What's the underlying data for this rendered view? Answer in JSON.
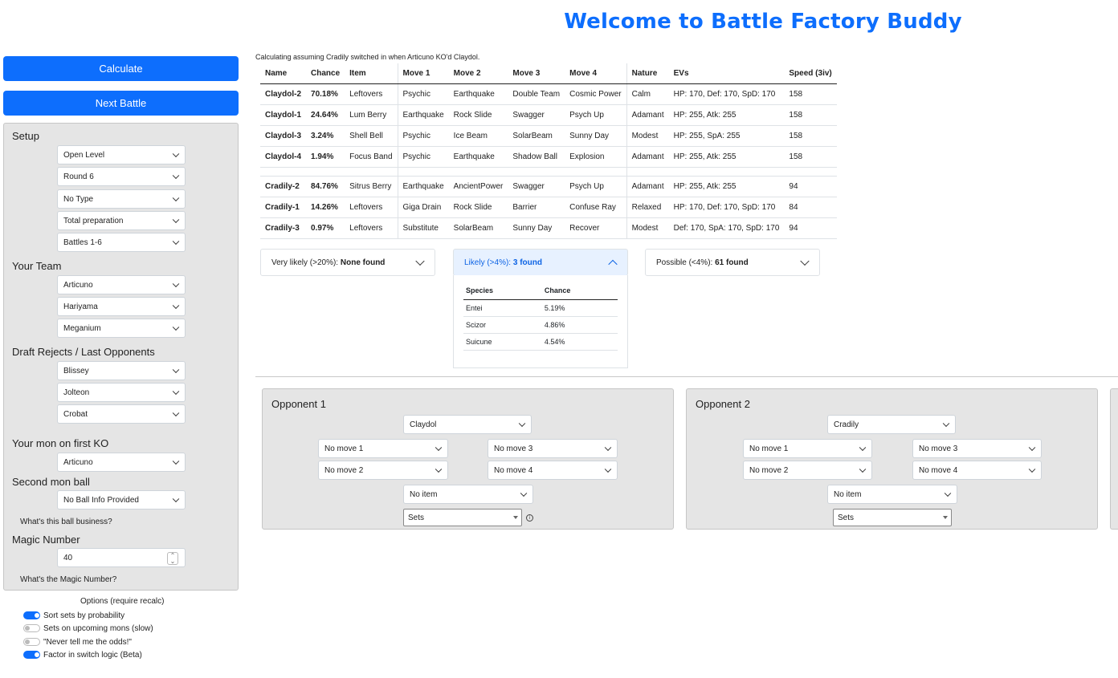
{
  "title": "Welcome to Battle Factory Buddy",
  "buttons": {
    "calculate": "Calculate",
    "next_battle": "Next Battle"
  },
  "setup": {
    "heading": "Setup",
    "level": "Open Level",
    "round": "Round 6",
    "type": "No Type",
    "preparation": "Total preparation",
    "battles": "Battles 1-6"
  },
  "team": {
    "heading": "Your Team",
    "members": [
      "Articuno",
      "Hariyama",
      "Meganium"
    ]
  },
  "rejects": {
    "heading": "Draft Rejects / Last Opponents",
    "members": [
      "Blissey",
      "Jolteon",
      "Crobat"
    ]
  },
  "first_ko": {
    "heading": "Your mon on first KO",
    "value": "Articuno"
  },
  "second_ball": {
    "heading": "Second mon ball",
    "value": "No Ball Info Provided",
    "help": "What's this ball business?"
  },
  "magic": {
    "heading": "Magic Number",
    "value": "40",
    "help": "What's the Magic Number?"
  },
  "options": {
    "heading": "Options (require recalc)",
    "items": [
      {
        "label": "Sort sets by probability",
        "on": true
      },
      {
        "label": "Sets on upcoming mons (slow)",
        "on": false
      },
      {
        "label": "\"Never tell me the odds!\"",
        "on": false
      },
      {
        "label": "Factor in switch logic (Beta)",
        "on": true
      }
    ]
  },
  "calc_note": "Calculating assuming Cradily switched in when Articuno KO'd Claydol.",
  "sets_table": {
    "headers": [
      "Name",
      "Chance",
      "Item",
      "Move 1",
      "Move 2",
      "Move 3",
      "Move 4",
      "Nature",
      "EVs",
      "Speed (3iv)"
    ],
    "group1": [
      [
        "Claydol-2",
        "70.18%",
        "Leftovers",
        "Psychic",
        "Earthquake",
        "Double Team",
        "Cosmic Power",
        "Calm",
        "HP: 170, Def: 170, SpD: 170",
        "158"
      ],
      [
        "Claydol-1",
        "24.64%",
        "Lum Berry",
        "Earthquake",
        "Rock Slide",
        "Swagger",
        "Psych Up",
        "Adamant",
        "HP: 255, Atk: 255",
        "158"
      ],
      [
        "Claydol-3",
        "3.24%",
        "Shell Bell",
        "Psychic",
        "Ice Beam",
        "SolarBeam",
        "Sunny Day",
        "Modest",
        "HP: 255, SpA: 255",
        "158"
      ],
      [
        "Claydol-4",
        "1.94%",
        "Focus Band",
        "Psychic",
        "Earthquake",
        "Shadow Ball",
        "Explosion",
        "Adamant",
        "HP: 255, Atk: 255",
        "158"
      ]
    ],
    "group2": [
      [
        "Cradily-2",
        "84.76%",
        "Sitrus Berry",
        "Earthquake",
        "AncientPower",
        "Swagger",
        "Psych Up",
        "Adamant",
        "HP: 255, Atk: 255",
        "94"
      ],
      [
        "Cradily-1",
        "14.26%",
        "Leftovers",
        "Giga Drain",
        "Rock Slide",
        "Barrier",
        "Confuse Ray",
        "Relaxed",
        "HP: 170, Def: 170, SpD: 170",
        "84"
      ],
      [
        "Cradily-3",
        "0.97%",
        "Leftovers",
        "Substitute",
        "SolarBeam",
        "Sunny Day",
        "Recover",
        "Modest",
        "Def: 170, SpA: 170, SpD: 170",
        "94"
      ]
    ]
  },
  "accordions": {
    "very_likely": {
      "label": "Very likely (>20%): ",
      "count": "None found"
    },
    "likely": {
      "label": "Likely (>4%): ",
      "count": "3 found"
    },
    "possible": {
      "label": "Possible (<4%): ",
      "count": "61 found"
    }
  },
  "likely_table": {
    "headers": [
      "Species",
      "Chance"
    ],
    "rows": [
      [
        "Entei",
        "5.19%"
      ],
      [
        "Scizor",
        "4.86%"
      ],
      [
        "Suicune",
        "4.54%"
      ]
    ]
  },
  "opponents": [
    {
      "title": "Opponent 1",
      "species": "Claydol",
      "move1": "No move 1",
      "move2": "No move 2",
      "move3": "No move 3",
      "move4": "No move 4",
      "item": "No item",
      "sets": "Sets"
    },
    {
      "title": "Opponent 2",
      "species": "Cradily",
      "move1": "No move 1",
      "move2": "No move 2",
      "move3": "No move 3",
      "move4": "No move 4",
      "item": "No item",
      "sets": "Sets"
    }
  ],
  "colors": {
    "primary": "#0d6efd",
    "panel": "#e5e5e5",
    "accordion_active": "#e7f1ff"
  }
}
